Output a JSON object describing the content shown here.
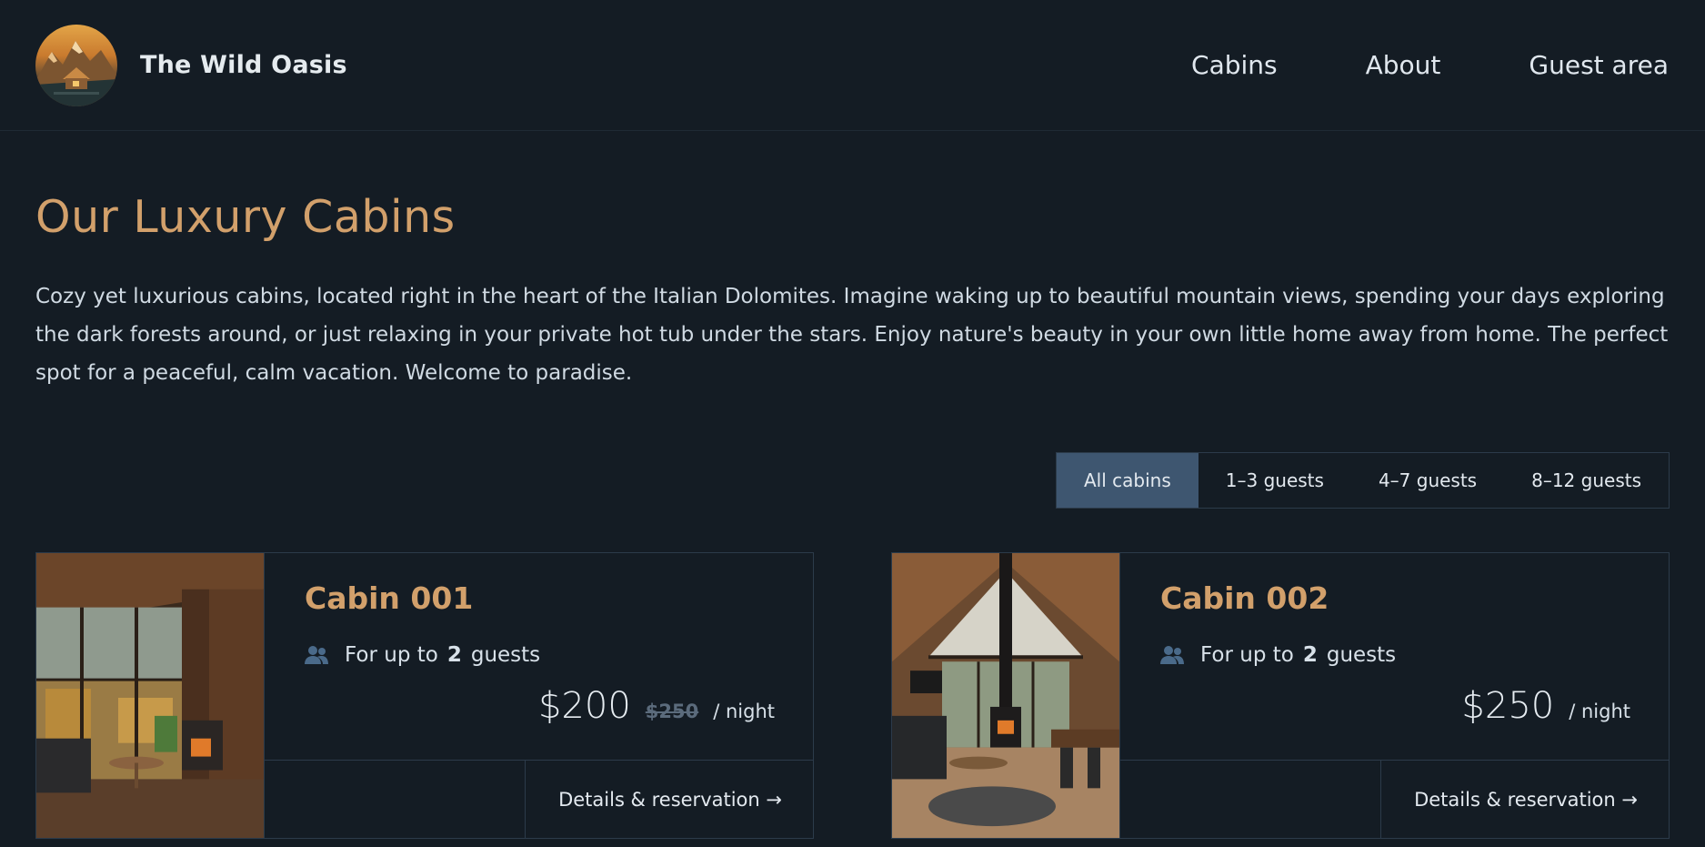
{
  "header": {
    "brand_name": "The Wild Oasis",
    "logo_icon": "cabin-mountain-logo",
    "nav": [
      {
        "label": "Cabins"
      },
      {
        "label": "About"
      },
      {
        "label": "Guest area"
      }
    ]
  },
  "main": {
    "title": "Our Luxury Cabins",
    "intro": "Cozy yet luxurious cabins, located right in the heart of the Italian Dolomites. Imagine waking up to beautiful mountain views, spending your days exploring the dark forests around, or just relaxing in your private hot tub under the stars. Enjoy nature's beauty in your own little home away from home. The perfect spot for a peaceful, calm vacation. Welcome to paradise.",
    "filters": [
      {
        "label": "All cabins",
        "active": true
      },
      {
        "label": "1–3 guests",
        "active": false
      },
      {
        "label": "4–7 guests",
        "active": false
      },
      {
        "label": "8–12 guests",
        "active": false
      }
    ],
    "cabins": [
      {
        "name": "Cabin 001",
        "guests_prefix": "For up to",
        "guests_count": "2",
        "guests_suffix": "guests",
        "price": "$200",
        "old_price": "$250",
        "per_night": "/ night",
        "details_label": "Details & reservation →"
      },
      {
        "name": "Cabin 002",
        "guests_prefix": "For up to",
        "guests_count": "2",
        "guests_suffix": "guests",
        "price": "$250",
        "old_price": "",
        "per_night": "/ night",
        "details_label": "Details & reservation →"
      }
    ]
  },
  "colors": {
    "background": "#141c24",
    "accent": "#d2a06b",
    "active_filter": "#3e5670",
    "border": "#2c3b4a"
  }
}
